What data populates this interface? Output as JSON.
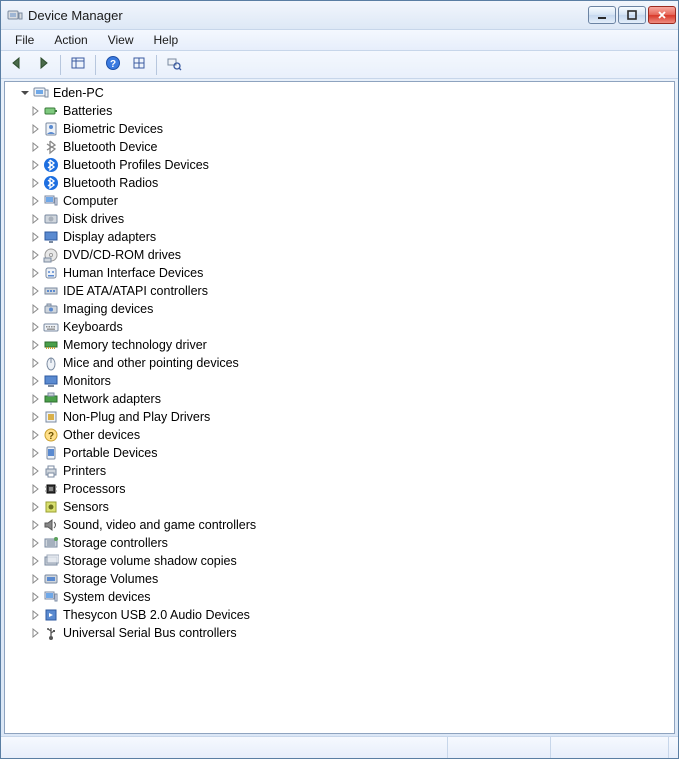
{
  "title": "Device Manager",
  "menus": [
    "File",
    "Action",
    "View",
    "Help"
  ],
  "root": {
    "label": "Eden-PC",
    "expanded": true
  },
  "categories": [
    {
      "label": "Batteries",
      "icon": "battery"
    },
    {
      "label": "Biometric Devices",
      "icon": "biometric"
    },
    {
      "label": "Bluetooth Device",
      "icon": "bluetooth-off"
    },
    {
      "label": "Bluetooth Profiles Devices",
      "icon": "bluetooth"
    },
    {
      "label": "Bluetooth Radios",
      "icon": "bluetooth"
    },
    {
      "label": "Computer",
      "icon": "computer"
    },
    {
      "label": "Disk drives",
      "icon": "disk"
    },
    {
      "label": "Display adapters",
      "icon": "display"
    },
    {
      "label": "DVD/CD-ROM drives",
      "icon": "dvd"
    },
    {
      "label": "Human Interface Devices",
      "icon": "hid"
    },
    {
      "label": "IDE ATA/ATAPI controllers",
      "icon": "ide"
    },
    {
      "label": "Imaging devices",
      "icon": "imaging"
    },
    {
      "label": "Keyboards",
      "icon": "keyboard"
    },
    {
      "label": "Memory technology driver",
      "icon": "memory"
    },
    {
      "label": "Mice and other pointing devices",
      "icon": "mouse"
    },
    {
      "label": "Monitors",
      "icon": "monitor"
    },
    {
      "label": "Network adapters",
      "icon": "network"
    },
    {
      "label": "Non-Plug and Play Drivers",
      "icon": "nonpnp"
    },
    {
      "label": "Other devices",
      "icon": "other"
    },
    {
      "label": "Portable Devices",
      "icon": "portable"
    },
    {
      "label": "Printers",
      "icon": "printer"
    },
    {
      "label": "Processors",
      "icon": "processor"
    },
    {
      "label": "Sensors",
      "icon": "sensor"
    },
    {
      "label": "Sound, video and game controllers",
      "icon": "sound"
    },
    {
      "label": "Storage controllers",
      "icon": "storage"
    },
    {
      "label": "Storage volume shadow copies",
      "icon": "shadow"
    },
    {
      "label": "Storage Volumes",
      "icon": "volume"
    },
    {
      "label": "System devices",
      "icon": "system"
    },
    {
      "label": "Thesycon USB 2.0 Audio Devices",
      "icon": "usb-audio"
    },
    {
      "label": "Universal Serial Bus controllers",
      "icon": "usb"
    }
  ],
  "toolbar": [
    {
      "name": "back",
      "icon": "arrow-left"
    },
    {
      "name": "forward",
      "icon": "arrow-right"
    },
    {
      "name": "sep"
    },
    {
      "name": "show-hidden",
      "icon": "grid-pane"
    },
    {
      "name": "sep"
    },
    {
      "name": "help",
      "icon": "help"
    },
    {
      "name": "properties",
      "icon": "grid-small"
    },
    {
      "name": "sep"
    },
    {
      "name": "scan",
      "icon": "scan"
    }
  ],
  "statusCellWidths": [
    447,
    103,
    118
  ]
}
